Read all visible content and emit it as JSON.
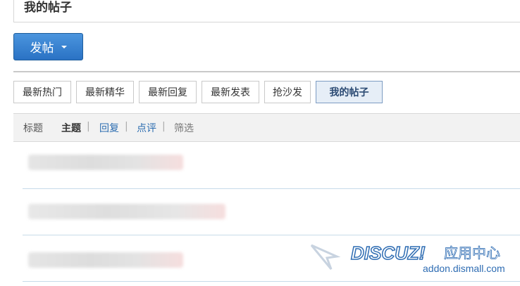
{
  "page": {
    "title": "我的帖子"
  },
  "toolbar": {
    "post_label": "发帖"
  },
  "tabs": [
    {
      "label": "最新热门",
      "active": false
    },
    {
      "label": "最新精华",
      "active": false
    },
    {
      "label": "最新回复",
      "active": false
    },
    {
      "label": "最新发表",
      "active": false
    },
    {
      "label": "抢沙发",
      "active": false
    },
    {
      "label": "我的帖子",
      "active": true
    }
  ],
  "filter": {
    "label": "标题",
    "items": [
      {
        "label": "主题",
        "selected": true
      },
      {
        "label": "回复",
        "selected": false
      },
      {
        "label": "点评",
        "selected": false
      }
    ],
    "screen_label": "筛选"
  },
  "watermark": {
    "brand": "DISCUZ!",
    "cn": "应用中心",
    "url": "addon.dismall.com"
  },
  "colors": {
    "accent": "#2a72c4",
    "link": "#2b6cb0",
    "watermark": "#2f6db3"
  }
}
